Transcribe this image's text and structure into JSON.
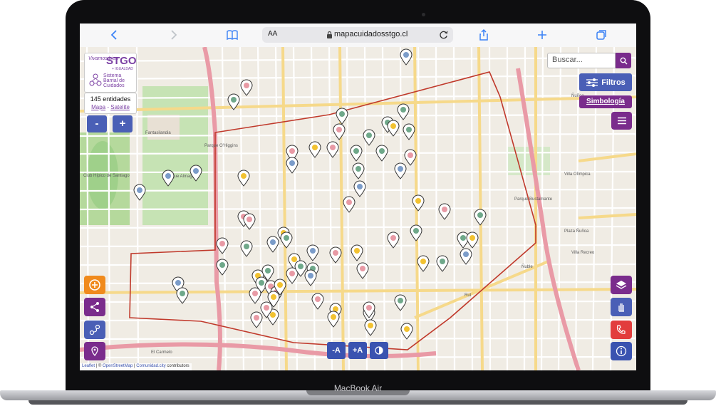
{
  "device": {
    "label": "MacBook Air"
  },
  "browser": {
    "text_size_label": "AA",
    "url": "mapacuidadosstgo.cl"
  },
  "branding": {
    "slogan": "Vivamos bien",
    "city": "STGO",
    "subtitle": "+ IGUALDAD",
    "system_name": "Sistema Barrial de Cuidados"
  },
  "map_info": {
    "entity_count": "145 entidades",
    "layer_map": "Mapa",
    "layer_separator": "-",
    "layer_satellite": "Satelite"
  },
  "zoom": {
    "in": "+",
    "out": "-"
  },
  "search": {
    "placeholder": "Buscar..."
  },
  "buttons": {
    "filters": "Filtros",
    "legend": "Simbología",
    "font_decrease": "-A",
    "font_increase": "+A"
  },
  "map_labels": [
    "Fantasilandia",
    "Parque O'Higgins",
    "Club Hípico de Santiago",
    "Parque Almagro",
    "Villa Olímpica",
    "Rut",
    "Parque Bustamante",
    "Plaza Ñuñoa",
    "Ñuble",
    "El Carmelo",
    "Villa Recreo",
    "Ñuñoa"
  ],
  "attribution": {
    "leaflet": "Leaflet",
    "separator": "| ©",
    "osm": "OpenStreetMap",
    "comunidad": "Comunidad.city",
    "contributors": "contributors"
  },
  "colors": {
    "purple": "#7a2c8c",
    "blue": "#4a5fb6",
    "orange": "#f08a1c",
    "red": "#e23d3d",
    "boundary": "#c0392b"
  }
}
